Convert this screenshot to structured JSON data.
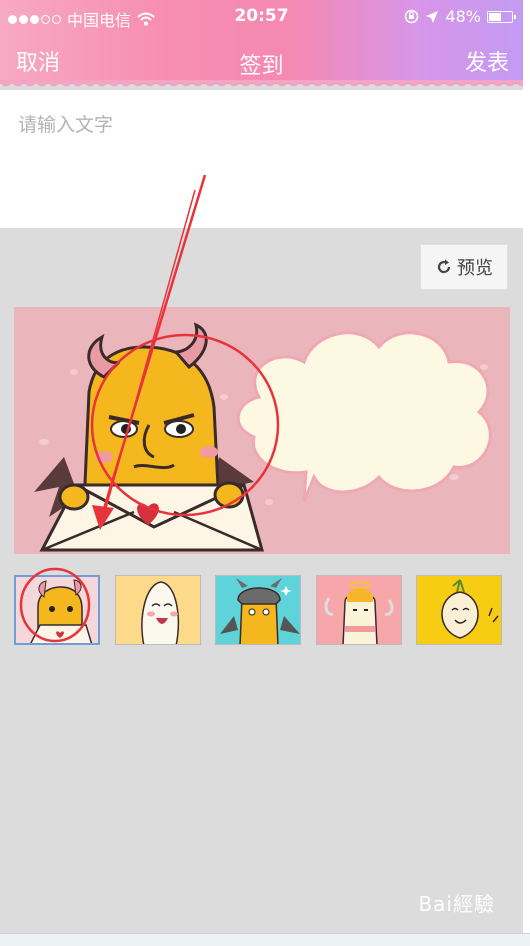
{
  "status_bar": {
    "carrier": "中国电信",
    "time": "20:57",
    "battery": "48%",
    "battery_level": 0.48,
    "signal_bars_filled": 3,
    "signal_bars_total": 5
  },
  "nav": {
    "cancel_label": "取消",
    "title": "签到",
    "post_label": "发表"
  },
  "compose": {
    "placeholder": "请输入文字"
  },
  "preview": {
    "label": "预览",
    "icon": "refresh-icon"
  },
  "stickers": {
    "selected_index": 0,
    "items": [
      "devil-letter-sticker",
      "white-ghost-sticker",
      "bat-devil-sticker",
      "angel-sticker",
      "onion-sticker"
    ]
  },
  "watermark": {
    "text": "Bai經驗"
  },
  "colors": {
    "header_start": "#f7a9c4",
    "header_end": "#c39af3",
    "annotation_red": "#e8333a",
    "selected_border": "#6f9fd8",
    "banner_bg": "#ebb6bb"
  }
}
